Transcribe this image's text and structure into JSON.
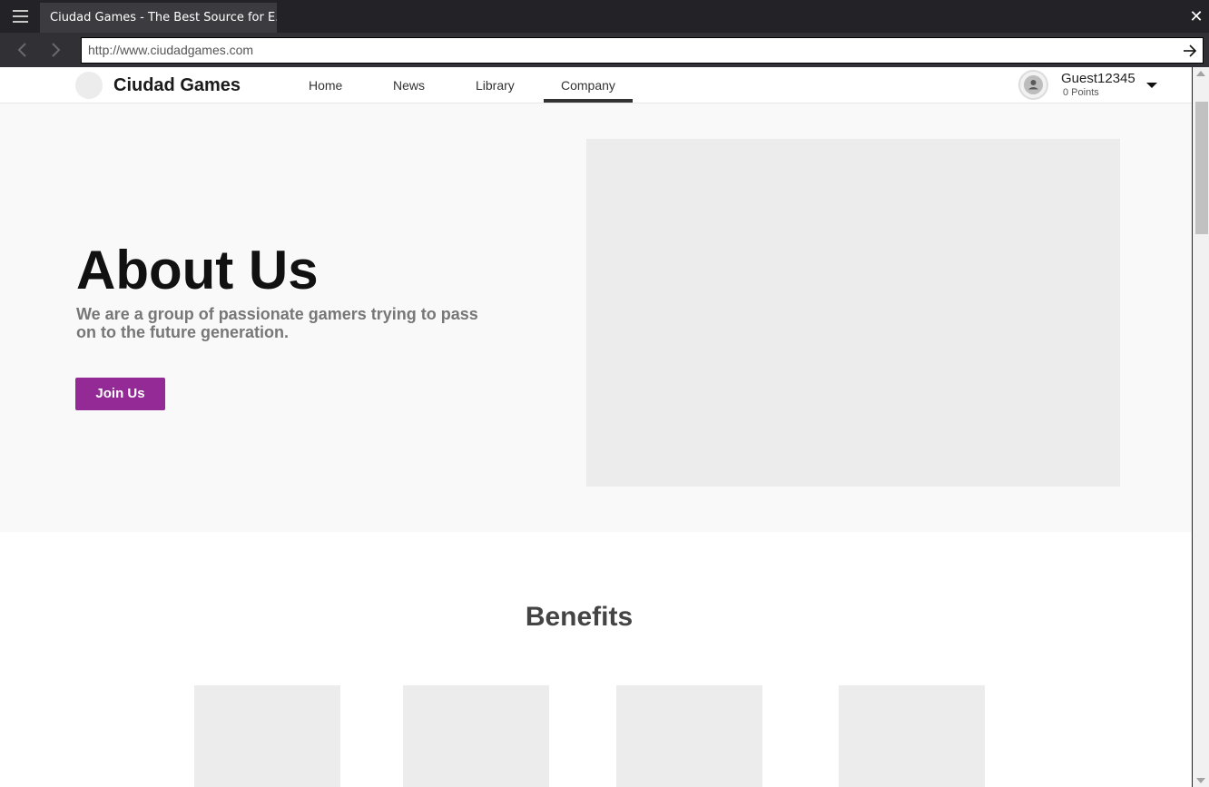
{
  "browser": {
    "tab_title": "Ciudad Games - The Best Source for E...",
    "url": "http://www.ciudadgames.com"
  },
  "site": {
    "brand": "Ciudad Games",
    "nav": [
      {
        "label": "Home"
      },
      {
        "label": "News"
      },
      {
        "label": "Library"
      },
      {
        "label": "Company",
        "active": true
      }
    ],
    "user": {
      "name": "Guest12345",
      "points": "0 Points"
    }
  },
  "hero": {
    "title": "About Us",
    "subtitle": "We are a group of passionate gamers trying to pass on to the future generation.",
    "cta_label": "Join Us"
  },
  "benefits": {
    "title": "Benefits",
    "cards": 4
  },
  "colors": {
    "accent": "#942a96",
    "chrome_dark": "#232327",
    "placeholder": "#ececec"
  }
}
